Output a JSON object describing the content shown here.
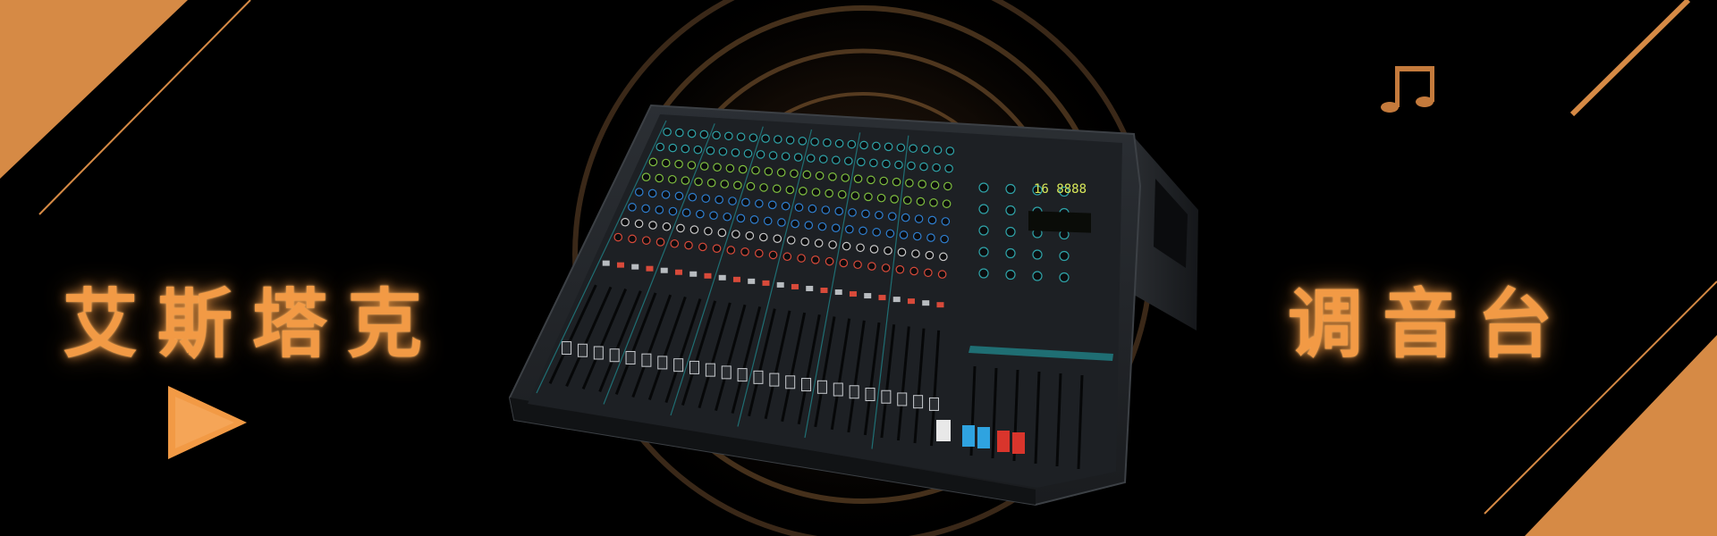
{
  "banner": {
    "brand_text": "艾斯塔克",
    "product_text": "调音台"
  },
  "colors": {
    "background": "#000000",
    "accent_orange": "#f29a45",
    "mixer_body": "#23262a",
    "panel_teal": "#1f6e73"
  },
  "icons": {
    "play": "play-triangle-icon",
    "music": "music-note-icon"
  }
}
